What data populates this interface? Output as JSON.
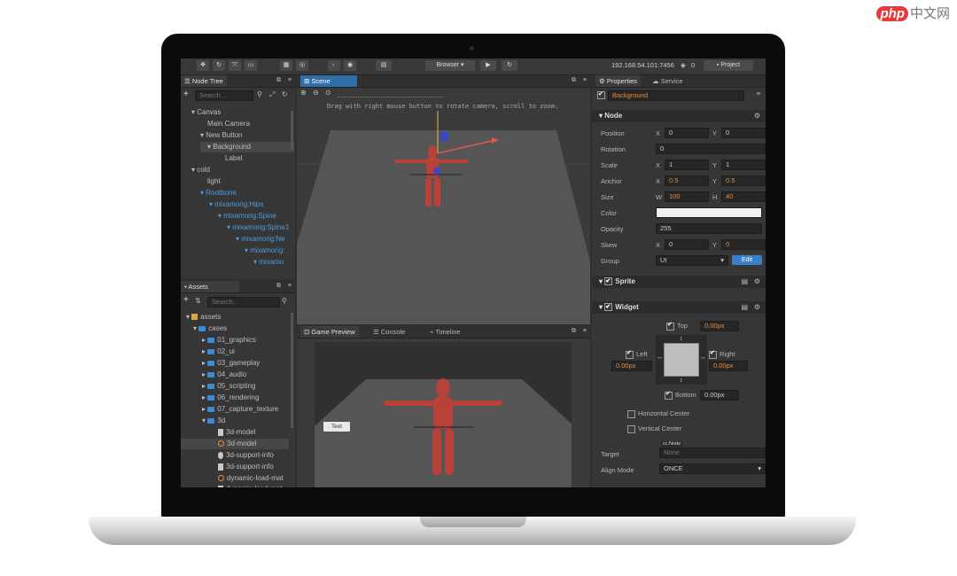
{
  "watermark": {
    "badge": "php",
    "text": "中文网"
  },
  "toolbar": {
    "platform": "Browser",
    "ip": "192.168.54.101:7456",
    "wifi_count": "0",
    "project_button": "Project"
  },
  "node_tree": {
    "title": "Node Tree",
    "search_placeholder": "Search...",
    "items": [
      {
        "label": "Canvas"
      },
      {
        "label": "Main Camera"
      },
      {
        "label": "New Button"
      },
      {
        "label": "Background"
      },
      {
        "label": "Label"
      },
      {
        "label": "cold"
      },
      {
        "label": "light"
      },
      {
        "label": "Rootbone"
      },
      {
        "label": "mixamorig:Hips"
      },
      {
        "label": "mixamorig:Spine"
      },
      {
        "label": "mixamorig:Spine1"
      },
      {
        "label": "mixamorig:Ne"
      },
      {
        "label": "mixamorig:"
      },
      {
        "label": "mixamo"
      }
    ]
  },
  "assets": {
    "title": "Assets",
    "search_placeholder": "Search...",
    "items": [
      {
        "label": "assets"
      },
      {
        "label": "cases"
      },
      {
        "label": "01_graphics"
      },
      {
        "label": "02_ui"
      },
      {
        "label": "03_gameplay"
      },
      {
        "label": "04_audio"
      },
      {
        "label": "05_scripting"
      },
      {
        "label": "06_rendering"
      },
      {
        "label": "07_capture_texture"
      },
      {
        "label": "3d"
      },
      {
        "label": "3d-model"
      },
      {
        "label": "3d-model"
      },
      {
        "label": "3d-support-info"
      },
      {
        "label": "3d-support-info"
      },
      {
        "label": "dynamic-load-mat"
      },
      {
        "label": "dynamic-load-mat"
      }
    ]
  },
  "scene": {
    "tab": "Scene",
    "hint": "Drag with right mouse button to rotate camera, scroll to zoom."
  },
  "bottom_tabs": {
    "game": "Game Preview",
    "console": "Console",
    "timeline": "Timeline"
  },
  "preview": {
    "button_label": "Text"
  },
  "properties": {
    "tab_properties": "Properties",
    "tab_service": "Service",
    "node_name": "Background",
    "section_node": "Node",
    "position_label": "Position",
    "pos_x": "0",
    "pos_y": "0",
    "rotation_label": "Rotation",
    "rotation": "0",
    "scale_label": "Scale",
    "scale_x": "1",
    "scale_y": "1",
    "anchor_label": "Anchor",
    "anchor_x": "0.5",
    "anchor_y": "0.5",
    "size_label": "Size",
    "size_w": "100",
    "size_h": "40",
    "color_label": "Color",
    "opacity_label": "Opacity",
    "opacity": "255",
    "skew_label": "Skew",
    "skew_x": "0",
    "skew_y": "0",
    "group_label": "Group",
    "group": "UI",
    "edit_button": "Edit",
    "section_sprite": "Sprite",
    "section_widget": "Widget",
    "top_label": "Top",
    "top_value": "0.00px",
    "left_label": "Left",
    "left_value": "0.00px",
    "right_label": "Right",
    "right_value": "0.00px",
    "bottom_label": "Bottom",
    "bottom_value": "0.00px",
    "hcenter_label": "Horizontal Center",
    "vcenter_label": "Vertical Center",
    "target_label": "Target",
    "target_tag": "cc.Node",
    "target_value": "None",
    "align_label": "Align Mode",
    "align_value": "ONCE"
  },
  "colors": {
    "accent": "#2f6ea8",
    "orange": "#e88c3c",
    "model": "#b8413a"
  }
}
